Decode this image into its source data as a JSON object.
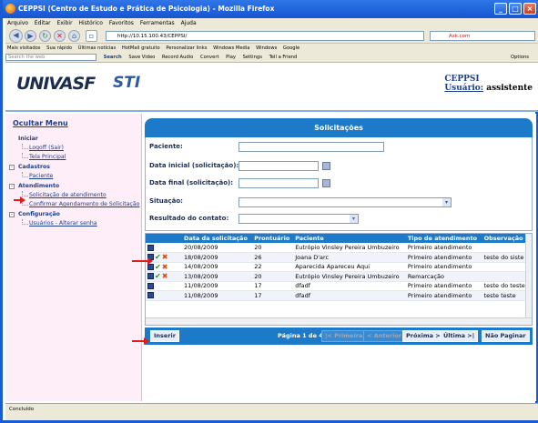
{
  "window": {
    "title": "CEPPSI (Centro de Estudo e Prática de Psicologia) - Mozilla Firefox"
  },
  "menubar": [
    "Arquivo",
    "Editar",
    "Exibir",
    "Histórico",
    "Favoritos",
    "Ferramentas",
    "Ajuda"
  ],
  "browser": {
    "url": "http://10.15.100.43/CEPPSI/",
    "search_value": "Ask.com"
  },
  "bookmarks": [
    "Mais visitados",
    "Sua rápido",
    "Últimas notícias",
    "HotMail gratuito",
    "Personalizar links",
    "Windows Media",
    "Windows",
    "Google"
  ],
  "toolbar": {
    "search_placeholder": "Search the web",
    "search_btn": "Search",
    "items": [
      "Save Video",
      "Record Audio",
      "Convert",
      "Play",
      "Settings",
      "Tell a Friend"
    ],
    "options": "Options"
  },
  "header": {
    "logo": "UNIVASF",
    "logo2": "STI",
    "app": "CEPPSI",
    "user_label": "Usuário:",
    "user_name": "assistente"
  },
  "sidebar": {
    "title": "Ocultar Menu",
    "groups": [
      {
        "label": "Iniciar",
        "box": "",
        "items": [
          "Logoff (Sair)",
          "Tela Principal"
        ]
      },
      {
        "label": "Cadastros",
        "box": "-",
        "items": [
          "Paciente"
        ]
      },
      {
        "label": "Atendimento",
        "box": "-",
        "items": [
          "Solicitação de atendimento",
          "Confirmar Agendamento de Solicitação"
        ]
      },
      {
        "label": "Configuração",
        "box": "-",
        "items": [
          "Usuários - Alterar senha"
        ]
      }
    ]
  },
  "panel": {
    "title": "Solicitações"
  },
  "form": {
    "paciente": "Paciente:",
    "data_inicial": "Data inicial (solicitação):",
    "data_final": "Data final (solicitação):",
    "situacao": "Situação:",
    "resultado": "Resultado do contato:"
  },
  "grid": {
    "columns": [
      "",
      "Data da solicitação",
      "Prontuário",
      "Paciente",
      "Tipo de atendimento",
      "Observação"
    ],
    "rows": [
      {
        "icons": "doc",
        "data": "20/08/2009",
        "pront": "20",
        "paciente": "Eutrópio Vinsley Pereira Umbuzeiro",
        "tipo": "Primeiro atendimento",
        "obs": ""
      },
      {
        "icons": "doc,ok,x",
        "data": "18/08/2009",
        "pront": "26",
        "paciente": "Joana D'arc",
        "tipo": "Primeiro atendimento",
        "obs": "teste do siste"
      },
      {
        "icons": "doc,ok,x",
        "data": "14/08/2009",
        "pront": "22",
        "paciente": "Aparecida Apareceu Aqui",
        "tipo": "Primeiro atendimento",
        "obs": ""
      },
      {
        "icons": "doc,ok,x",
        "data": "13/08/2009",
        "pront": "20",
        "paciente": "Eutrópio Vinsley Pereira Umbuzeiro",
        "tipo": "Remarcação",
        "obs": ""
      },
      {
        "icons": "doc",
        "data": "11/08/2009",
        "pront": "17",
        "paciente": "dfadf",
        "tipo": "Primeiro atendimento",
        "obs": "teste do teste"
      },
      {
        "icons": "doc",
        "data": "11/08/2009",
        "pront": "17",
        "paciente": "dfadf",
        "tipo": "Primeiro atendimento",
        "obs": "teste teste"
      }
    ]
  },
  "pager": {
    "inserir": "Inserir",
    "page_text": "Página 1 de 4",
    "primeira": "|< Primeira",
    "anterior": "< Anterior",
    "proxima": "Próxima >",
    "ultima": "Última >|",
    "nao_paginar": "Não Paginar"
  },
  "status": "Concluído"
}
